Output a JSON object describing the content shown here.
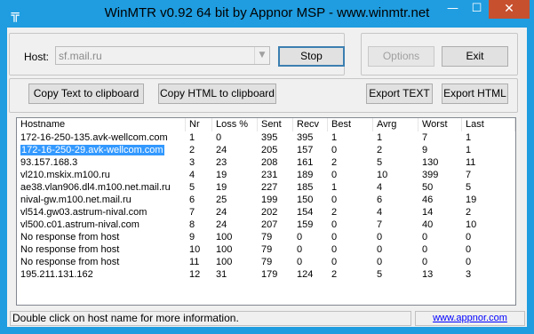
{
  "window": {
    "title": "WinMTR v0.92 64 bit by Appnor MSP - www.winmtr.net",
    "min_glyph": "—",
    "max_glyph": "☐",
    "close_glyph": "✕",
    "app_icon_glyph": "╦"
  },
  "host": {
    "label": "Host:",
    "value": "sf.mail.ru",
    "arrow_glyph": "▼"
  },
  "buttons": {
    "stop": "Stop",
    "options": "Options",
    "exit": "Exit",
    "copy_text": "Copy Text to clipboard",
    "copy_html": "Copy HTML to clipboard",
    "export_text": "Export TEXT",
    "export_html": "Export HTML"
  },
  "table": {
    "columns": [
      "Hostname",
      "Nr",
      "Loss %",
      "Sent",
      "Recv",
      "Best",
      "Avrg",
      "Worst",
      "Last"
    ],
    "rows": [
      [
        "172-16-250-135.avk-wellcom.com",
        "1",
        "0",
        "395",
        "395",
        "1",
        "1",
        "7",
        "1"
      ],
      [
        "172-16-250-29.avk-wellcom.com",
        "2",
        "24",
        "205",
        "157",
        "0",
        "2",
        "9",
        "1"
      ],
      [
        "93.157.168.3",
        "3",
        "23",
        "208",
        "161",
        "2",
        "5",
        "130",
        "11"
      ],
      [
        "vl210.mskix.m100.ru",
        "4",
        "19",
        "231",
        "189",
        "0",
        "10",
        "399",
        "7"
      ],
      [
        "ae38.vlan906.dl4.m100.net.mail.ru",
        "5",
        "19",
        "227",
        "185",
        "1",
        "4",
        "50",
        "5"
      ],
      [
        "nival-gw.m100.net.mail.ru",
        "6",
        "25",
        "199",
        "150",
        "0",
        "6",
        "46",
        "19"
      ],
      [
        "vl514.gw03.astrum-nival.com",
        "7",
        "24",
        "202",
        "154",
        "2",
        "4",
        "14",
        "2"
      ],
      [
        "vl500.c01.astrum-nival.com",
        "8",
        "24",
        "207",
        "159",
        "0",
        "7",
        "40",
        "10"
      ],
      [
        "No response from host",
        "9",
        "100",
        "79",
        "0",
        "0",
        "0",
        "0",
        "0"
      ],
      [
        "No response from host",
        "10",
        "100",
        "79",
        "0",
        "0",
        "0",
        "0",
        "0"
      ],
      [
        "No response from host",
        "11",
        "100",
        "79",
        "0",
        "0",
        "0",
        "0",
        "0"
      ],
      [
        "195.211.131.162",
        "12",
        "31",
        "179",
        "124",
        "2",
        "5",
        "13",
        "3"
      ]
    ]
  },
  "status": {
    "text": "Double click on host name for more information.",
    "link": "www.appnor.com"
  }
}
